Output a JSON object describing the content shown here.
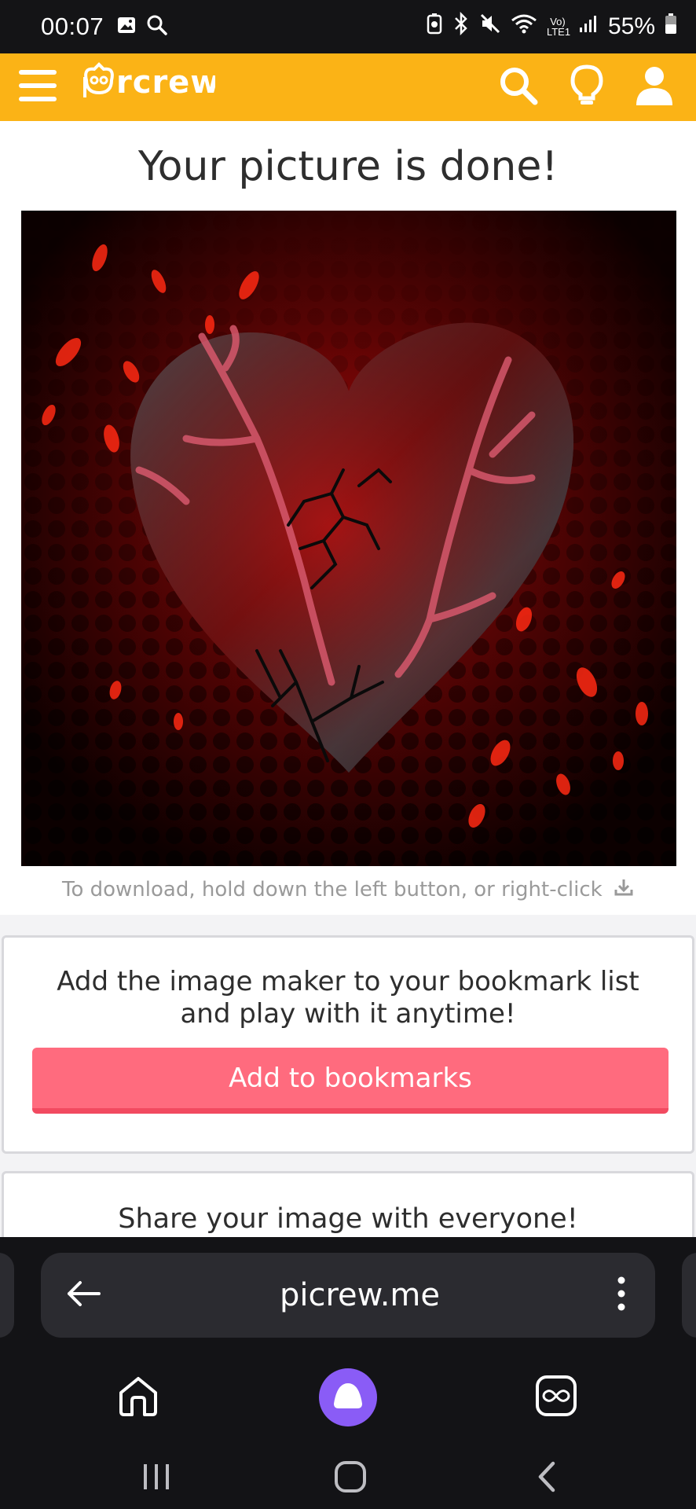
{
  "status_bar": {
    "time": "00:07",
    "battery": "55%",
    "lte_label": "Vo) LTE1"
  },
  "app_bar": {
    "logo_text": "Picrew",
    "colors": {
      "background": "#fbb316"
    }
  },
  "result": {
    "title": "Your picture is done!",
    "download_hint": "To download, hold down the left button, or right-click"
  },
  "bookmark_card": {
    "text_line1": "Add the image maker to your bookmark list",
    "text_line2": "and play with it anytime!",
    "button_label": "Add to bookmarks"
  },
  "share_card": {
    "text": "Share your image with everyone!"
  },
  "browser": {
    "url": "picrew.me"
  },
  "colors": {
    "accent": "#fbb316",
    "bookmark_button": "#ff6b7e",
    "browser_bg": "#131316",
    "assistant": "#8a5cf6"
  }
}
